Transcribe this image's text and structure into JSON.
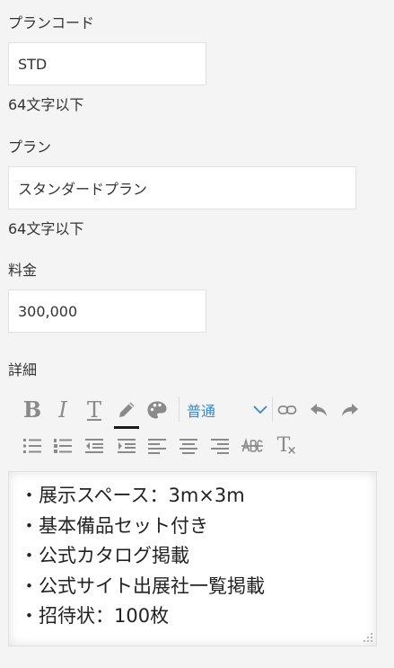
{
  "plan_code": {
    "label": "プランコード",
    "value": "STD",
    "hint": "64文字以下"
  },
  "plan": {
    "label": "プラン",
    "value": "スタンダードプラン",
    "hint": "64文字以下"
  },
  "price": {
    "label": "料金",
    "value": "300,000"
  },
  "details": {
    "label": "詳細",
    "toolbar": {
      "bold": "B",
      "italic": "I",
      "text_style": "T",
      "format_value": "普通",
      "clear_format": "T"
    },
    "content_lines": [
      "・展示スペース：3m×3m",
      "・基本備品セット付き",
      "・公式カタログ掲載",
      "・公式サイト出展社一覧掲載",
      "・招待状：100枚"
    ]
  },
  "colors": {
    "link_blue": "#3a86c8",
    "icon_gray": "#8a8a8a",
    "background": "#f4f4f4"
  }
}
